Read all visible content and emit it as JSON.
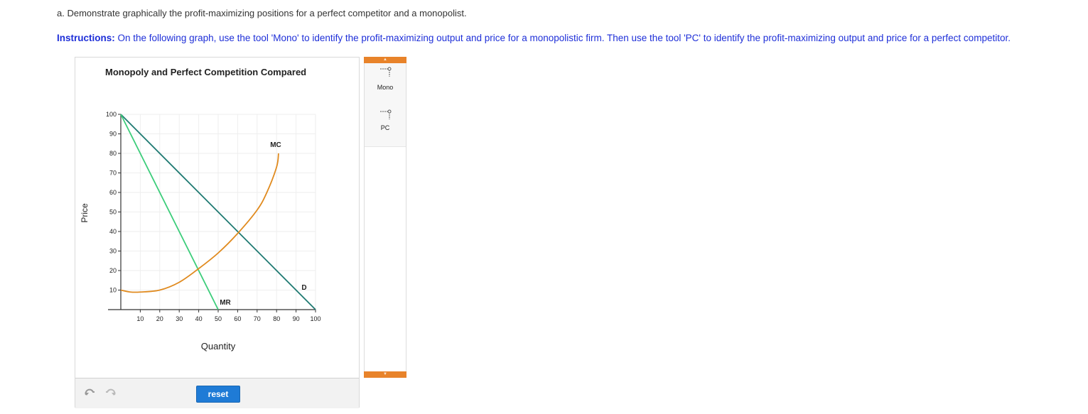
{
  "question": "a. Demonstrate graphically the profit-maximizing positions for a perfect competitor and a monopolist.",
  "instructions": {
    "label": "Instructions:",
    "text": " On the following graph, use the tool 'Mono' to identify the profit-maximizing output and price for a monopolistic firm. Then use the tool 'PC' to identify the profit-maximizing output and price for a perfect competitor."
  },
  "graph": {
    "title": "Monopoly and Perfect Competition Compared"
  },
  "controls": {
    "reset_label": "reset",
    "undo_icon": "undo-icon",
    "redo_icon": "redo-icon"
  },
  "toolbox": {
    "tools": [
      {
        "label": "Mono",
        "icon": "point-drop-line-icon"
      },
      {
        "label": "PC",
        "icon": "point-drop-line-icon"
      }
    ]
  },
  "colors": {
    "instructions": "#1e2fd8",
    "demand": "#1f7a72",
    "mr": "#3ccd7a",
    "mc": "#e08a1e",
    "reset_button": "#1f7bd6",
    "toolbox_arrow": "#e8832a"
  },
  "chart_data": {
    "type": "line",
    "title": "Monopoly and Perfect Competition Compared",
    "xlabel": "Quantity",
    "ylabel": "Price",
    "xlim": [
      0,
      100
    ],
    "ylim": [
      0,
      100
    ],
    "x_ticks": [
      10,
      20,
      30,
      40,
      50,
      60,
      70,
      80,
      90,
      100
    ],
    "y_ticks": [
      10,
      20,
      30,
      40,
      50,
      60,
      70,
      80,
      90,
      100
    ],
    "grid": true,
    "series": [
      {
        "name": "D",
        "points": [
          [
            0,
            100
          ],
          [
            100,
            0
          ]
        ]
      },
      {
        "name": "MR",
        "points": [
          [
            0,
            100
          ],
          [
            50,
            0
          ]
        ]
      },
      {
        "name": "MC",
        "points": [
          [
            0,
            10
          ],
          [
            5,
            9
          ],
          [
            10,
            9
          ],
          [
            20,
            10
          ],
          [
            30,
            14
          ],
          [
            40,
            21
          ],
          [
            50,
            29
          ],
          [
            60,
            39
          ],
          [
            70,
            51
          ],
          [
            75,
            60
          ],
          [
            80,
            73
          ],
          [
            81,
            80
          ]
        ]
      }
    ]
  }
}
